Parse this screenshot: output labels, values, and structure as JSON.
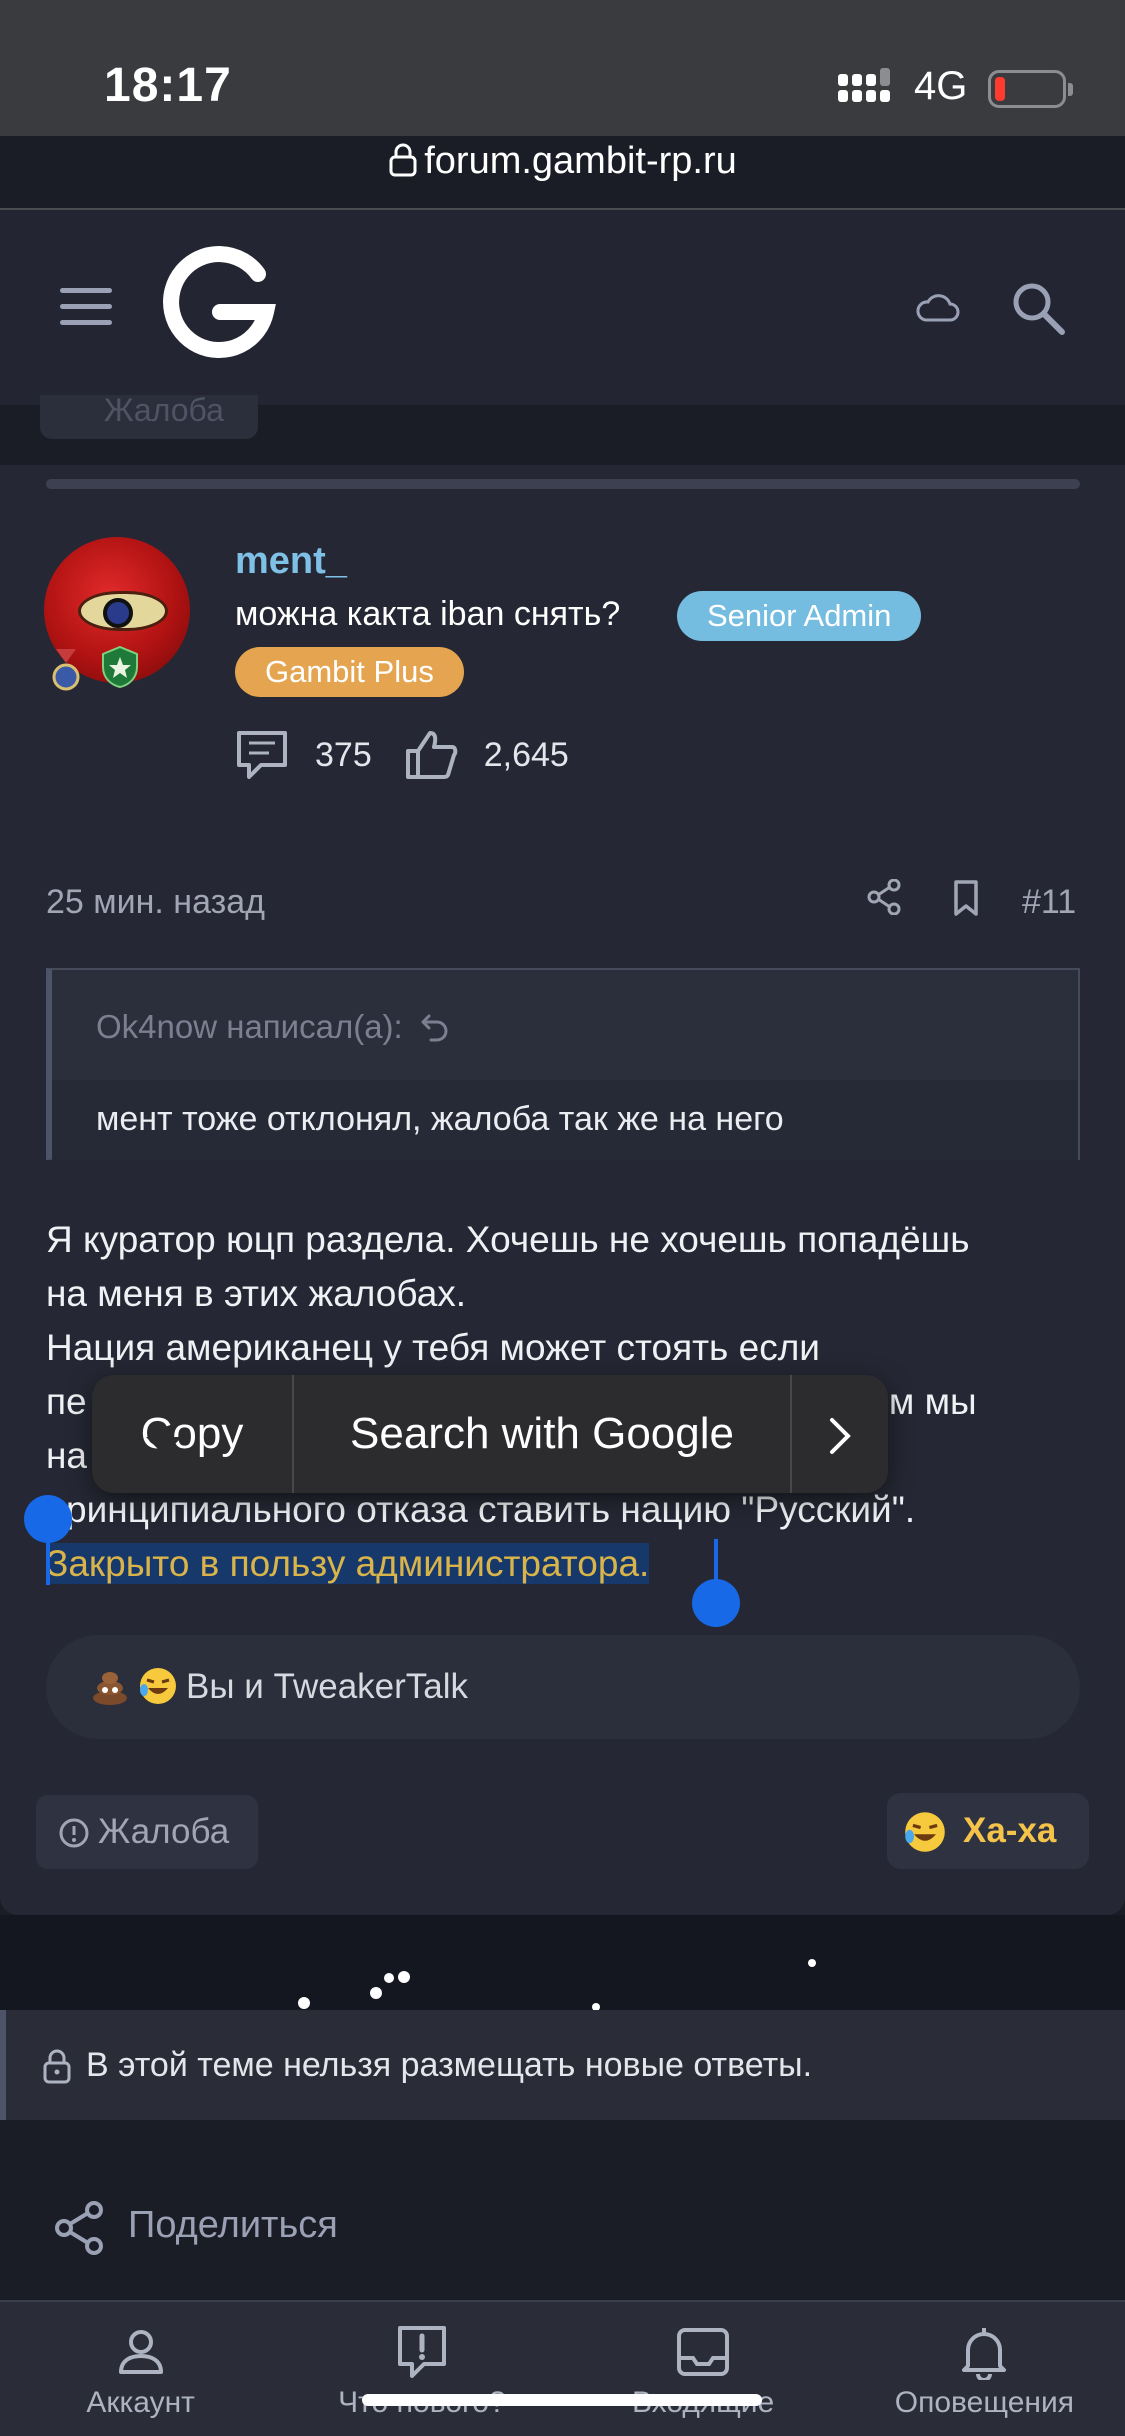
{
  "status_bar": {
    "time": "18:17",
    "network": "4G",
    "battery_color": "#ff3b30"
  },
  "browser": {
    "url": "forum.gambit-rp.ru"
  },
  "header": {
    "menu_icon": "hamburger-icon",
    "logo_icon": "gambit-logo",
    "cloud_icon": "cloud-icon",
    "search_icon": "search-icon"
  },
  "previous_post": {
    "report_label": "Жалоба"
  },
  "post": {
    "username": "ment_",
    "user_title": "можна какта iban снять?",
    "role_badge": "Senior Admin",
    "plus_badge": "Gambit Plus",
    "messages_count": "375",
    "reactions_count": "2,645",
    "date": "25 мин. назад",
    "post_number": "#11",
    "quote": {
      "author": "Ok4now написал(а):",
      "text": "мент тоже отклонял, жалоба так же на него"
    },
    "body": {
      "line1": "Я куратор юцп раздела. Хочешь не хочешь попадёшь",
      "line2": "на меня в этих жалобах.",
      "line3": "Нация американец у тебя может стоять если",
      "line4_start": "пе",
      "line4_end": "ожем мы",
      "line5": "на",
      "line6": "принципиального отказа ставить нацию \"Русский\".",
      "selected_line": "Закрыто в пользу администратора."
    },
    "reactions_text": "Вы и TweakerTalk",
    "report_label": "Жалоба",
    "haha_label": "Ха-ха"
  },
  "context_menu": {
    "copy": "Copy",
    "search": "Search with Google",
    "more": "›"
  },
  "locked_notice": "В этой теме нельзя размещать новые ответы.",
  "share_label": "Поделиться",
  "bottom_nav": [
    {
      "label": "Аккаунт",
      "icon": "account-icon"
    },
    {
      "label": "Что нового?",
      "icon": "whats-new-icon"
    },
    {
      "label": "Входящие",
      "icon": "inbox-icon"
    },
    {
      "label": "Оповещения",
      "icon": "bell-icon"
    }
  ],
  "colors": {
    "accent_blue": "#74bde0",
    "plus_orange": "#e5a44f",
    "username": "#7ec0e6",
    "selection": "#17386b",
    "selection_text": "#d9b44a"
  }
}
